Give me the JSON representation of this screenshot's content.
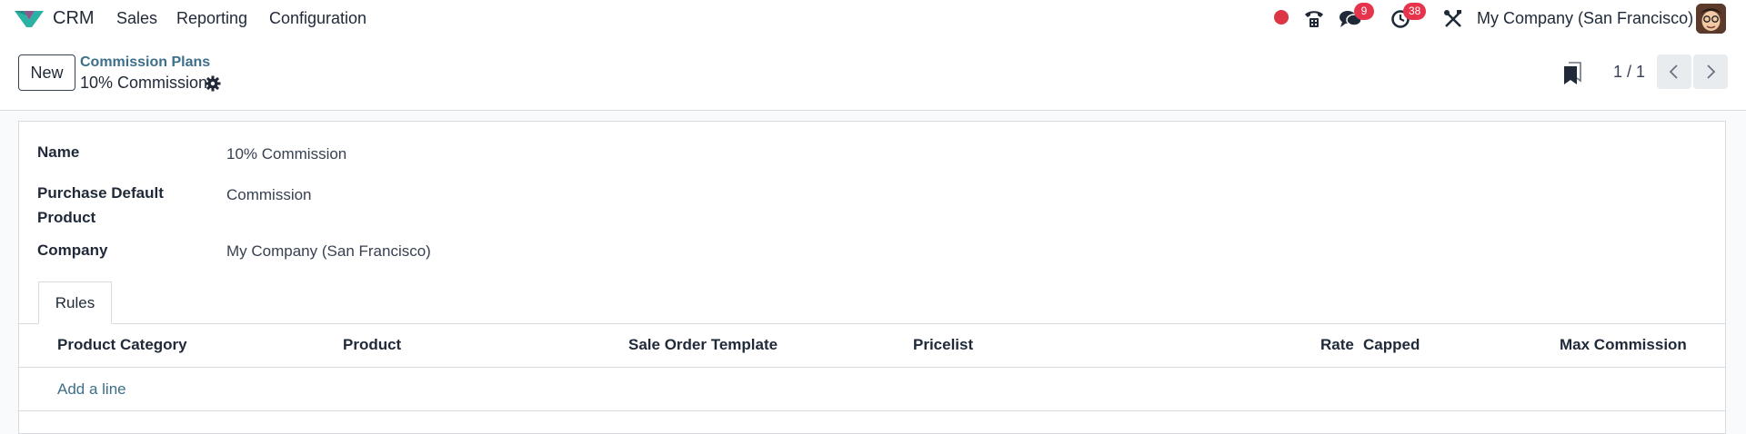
{
  "navbar": {
    "app_name": "CRM",
    "menu": [
      "Sales",
      "Reporting",
      "Configuration"
    ],
    "messages_badge": "9",
    "activities_badge": "38",
    "company": "My Company (San Francisco)",
    "icons": [
      "recording-dot-icon",
      "phone-icon",
      "chat-icon",
      "clock-icon",
      "tools-icon"
    ]
  },
  "control": {
    "new_label": "New",
    "breadcrumb_parent": "Commission Plans",
    "breadcrumb_current": "10% Commission",
    "pager": "1 / 1"
  },
  "form": {
    "fields": [
      {
        "label": "Name",
        "value": "10% Commission"
      },
      {
        "label": "Purchase Default Product",
        "value": "Commission"
      },
      {
        "label": "Company",
        "value": "My Company (San Francisco)"
      }
    ],
    "tab_label": "Rules",
    "columns": [
      "Product Category",
      "Product",
      "Sale Order Template",
      "Pricelist",
      "Rate",
      "Capped",
      "Max Commission"
    ],
    "add_line_label": "Add a line"
  },
  "colors": {
    "accent": "#3d6f8a",
    "badge": "#e5344b",
    "recording": "#dc3545"
  }
}
